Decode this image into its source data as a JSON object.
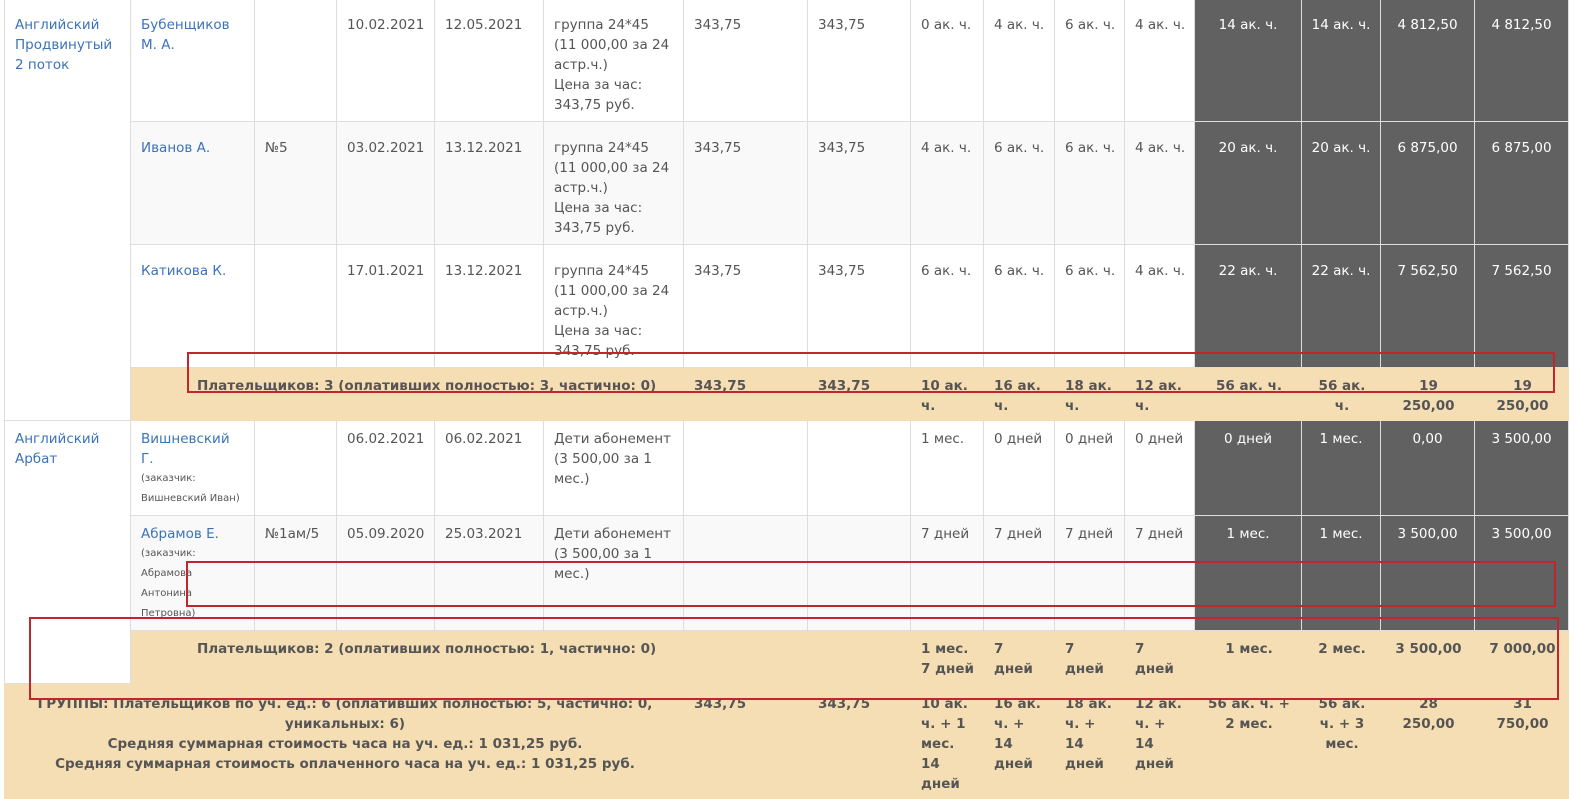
{
  "groups": [
    {
      "name": "Английский Продвинутый 2 поток",
      "rows": [
        {
          "student": "Бубенщиков М. А.",
          "customer": "",
          "contract": "",
          "start": "10.02.2021",
          "end": "12.05.2021",
          "tariff_line1": "группа 24*45",
          "tariff_line2": "(11 000,00 за 24 астр.ч.)",
          "tariff_line3": "Цена за час: 343,75 руб.",
          "p1": "343,75",
          "p2": "343,75",
          "m1": "0 ак. ч.",
          "m2": "4 ак. ч.",
          "m3": "6 ак. ч.",
          "m4": "4 ак. ч.",
          "d1": "14 ак. ч.",
          "d2": "14 ак. ч.",
          "d3": "4 812,50",
          "d4": "4 812,50"
        },
        {
          "student": "Иванов А.",
          "customer": "",
          "contract": "№5",
          "start": "03.02.2021",
          "end": "13.12.2021",
          "tariff_line1": "группа 24*45",
          "tariff_line2": "(11 000,00 за 24 астр.ч.)",
          "tariff_line3": "Цена за час: 343,75 руб.",
          "p1": "343,75",
          "p2": "343,75",
          "m1": "4 ак. ч.",
          "m2": "6 ак. ч.",
          "m3": "6 ак. ч.",
          "m4": "4 ак. ч.",
          "d1": "20 ак. ч.",
          "d2": "20 ак. ч.",
          "d3": "6 875,00",
          "d4": "6 875,00"
        },
        {
          "student": "Катикова К.",
          "customer": "",
          "contract": "",
          "start": "17.01.2021",
          "end": "13.12.2021",
          "tariff_line1": "группа 24*45",
          "tariff_line2": "(11 000,00 за 24 астр.ч.)",
          "tariff_line3": "Цена за час: 343,75 руб.",
          "p1": "343,75",
          "p2": "343,75",
          "m1": "6 ак. ч.",
          "m2": "6 ак. ч.",
          "m3": "6 ак. ч.",
          "m4": "4 ак. ч.",
          "d1": "22 ак. ч.",
          "d2": "22 ак. ч.",
          "d3": "7 562,50",
          "d4": "7 562,50"
        }
      ],
      "summary": {
        "label": "Плательщиков: 3 (оплативших полностью: 3, частично: 0)",
        "p1": "343,75",
        "p2": "343,75",
        "m1": "10 ак. ч.",
        "m2": "16 ак. ч.",
        "m3": "18 ак. ч.",
        "m4": "12 ак. ч.",
        "d1": "56 ак. ч.",
        "d2": "56 ак. ч.",
        "d3": "19 250,00",
        "d4": "19 250,00"
      }
    },
    {
      "name": "Английский Арбат",
      "rows": [
        {
          "student": "Вишневский Г.",
          "customer": "(заказчик: Вишневский Иван)",
          "contract": "",
          "start": "06.02.2021",
          "end": "06.02.2021",
          "tariff_line1": "Дети абонемент",
          "tariff_line2": "(3 500,00 за 1 мес.)",
          "tariff_line3": "",
          "p1": "",
          "p2": "",
          "m1": "1 мес.",
          "m2": "0 дней",
          "m3": "0 дней",
          "m4": "0 дней",
          "d1": "0 дней",
          "d2": "1 мес.",
          "d3": "0,00",
          "d4": "3 500,00"
        },
        {
          "student": "Абрамов Е.",
          "customer": "(заказчик: Абрамова Антонина Петровна)",
          "contract": "№1ам/5",
          "start": "05.09.2020",
          "end": "25.03.2021",
          "tariff_line1": "Дети абонемент",
          "tariff_line2": "(3 500,00 за 1 мес.)",
          "tariff_line3": "",
          "p1": "",
          "p2": "",
          "m1": "7 дней",
          "m2": "7 дней",
          "m3": "7 дней",
          "m4": "7 дней",
          "d1": "1 мес.",
          "d2": "1 мес.",
          "d3": "3 500,00",
          "d4": "3 500,00"
        }
      ],
      "summary": {
        "label": "Плательщиков: 2 (оплативших полностью: 1, частично: 0)",
        "p1": "",
        "p2": "",
        "m1": "1 мес. 7 дней",
        "m2": "7 дней",
        "m3": "7 дней",
        "m4": "7 дней",
        "d1": "1 мес.",
        "d2": "2 мес.",
        "d3": "3 500,00",
        "d4": "7 000,00"
      }
    }
  ],
  "total": {
    "line1": "ГРУППЫ: Плательщиков по уч. ед.: 6 (оплативших полностью: 5, частично: 0, уникальных: 6)",
    "line2": "Средняя суммарная стоимость часа на уч. ед.: 1 031,25 руб.",
    "line3": "Средняя суммарная стоимость оплаченного часа на уч. ед.: 1 031,25 руб.",
    "p1": "343,75",
    "p2": "343,75",
    "m1": "10 ак. ч. + 1 мес. 14 дней",
    "m2": "16 ак. ч. + 14 дней",
    "m3": "18 ак. ч. + 14 дней",
    "m4": "12 ак. ч. + 14 дней",
    "d1": "56 ак. ч. + 2 мес.",
    "d2": "56 ак. ч. + 3 мес.",
    "d3": "28 250,00",
    "d4": "31 750,00"
  },
  "colors": {
    "accent_link": "#3b73b9",
    "dark_cell": "#616161",
    "summary_bg": "#f5deb3",
    "highlight_border": "#c0262d"
  }
}
